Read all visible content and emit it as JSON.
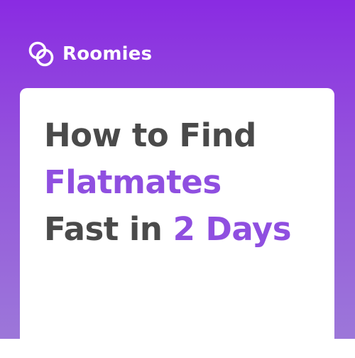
{
  "brand": {
    "name": "Roomies",
    "logo_icon": "interlocking-rings-icon"
  },
  "headline": {
    "line1": "How to Find",
    "line2_accent": "Flatmates",
    "line3_prefix": "Fast in ",
    "line3_accent": "2 Days"
  },
  "colors": {
    "background_top": "#8a2be2",
    "background_bottom": "#9c77d9",
    "card": "#ffffff",
    "text_dark": "#4a4a4a",
    "accent": "#8f4fe0",
    "brand_text": "#ffffff"
  }
}
